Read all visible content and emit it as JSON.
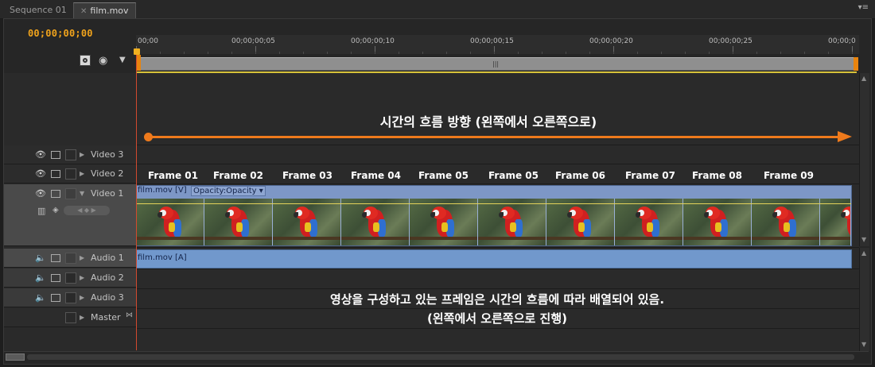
{
  "tabs": [
    {
      "label": "Sequence 01",
      "active": false
    },
    {
      "label": "film.mov",
      "active": true
    }
  ],
  "tab_close": "✕",
  "panel_menu_icon": "▾≡",
  "timecode": "00;00;00;00",
  "ruler_ticks": [
    "00;00",
    "00;00;00;05",
    "00;00;00;10",
    "00;00;00;15",
    "00;00;00;20",
    "00;00;00;25",
    "00;00;0"
  ],
  "work_area_grip": "|||",
  "tracks": {
    "video3": {
      "name": "Video 3"
    },
    "video2": {
      "name": "Video 2"
    },
    "video1": {
      "name": "Video 1"
    },
    "audio1": {
      "name": "Audio 1"
    },
    "audio2": {
      "name": "Audio 2"
    },
    "audio3": {
      "name": "Audio 3"
    },
    "master": {
      "name": "Master"
    }
  },
  "video_clip": {
    "name": "film.mov [V]",
    "effect": "Opacity:Opacity ▾"
  },
  "audio_clip": {
    "name": "film.mov [A]"
  },
  "annotations": {
    "direction": "시간의 흐름 방향 (왼쪽에서 오른쪽으로)",
    "note_line1": "영상을 구성하고 있는 프레임은 시간의 흐름에 따라 배열되어 있음.",
    "note_line2": "(왼쪽에서 오른쪽으로 진행)"
  },
  "frame_labels": [
    "Frame 01",
    "Frame 02",
    "Frame 03",
    "Frame 04",
    "Frame 05",
    "Frame 05",
    "Frame 06",
    "Frame 07",
    "Frame 08",
    "Frame 09"
  ],
  "colors": {
    "timecode": "#f0a31c",
    "playhead": "#d24a2f",
    "arrow": "#ee7a1c",
    "video_clip": "#7d97c6",
    "audio_clip": "#7198cc"
  },
  "icons": [
    "snap-icon",
    "marker-icon",
    "flag-icon",
    "eye-icon",
    "speaker-icon",
    "filmstrip-icon",
    "lock-icon",
    "expand-arrow-icon"
  ]
}
